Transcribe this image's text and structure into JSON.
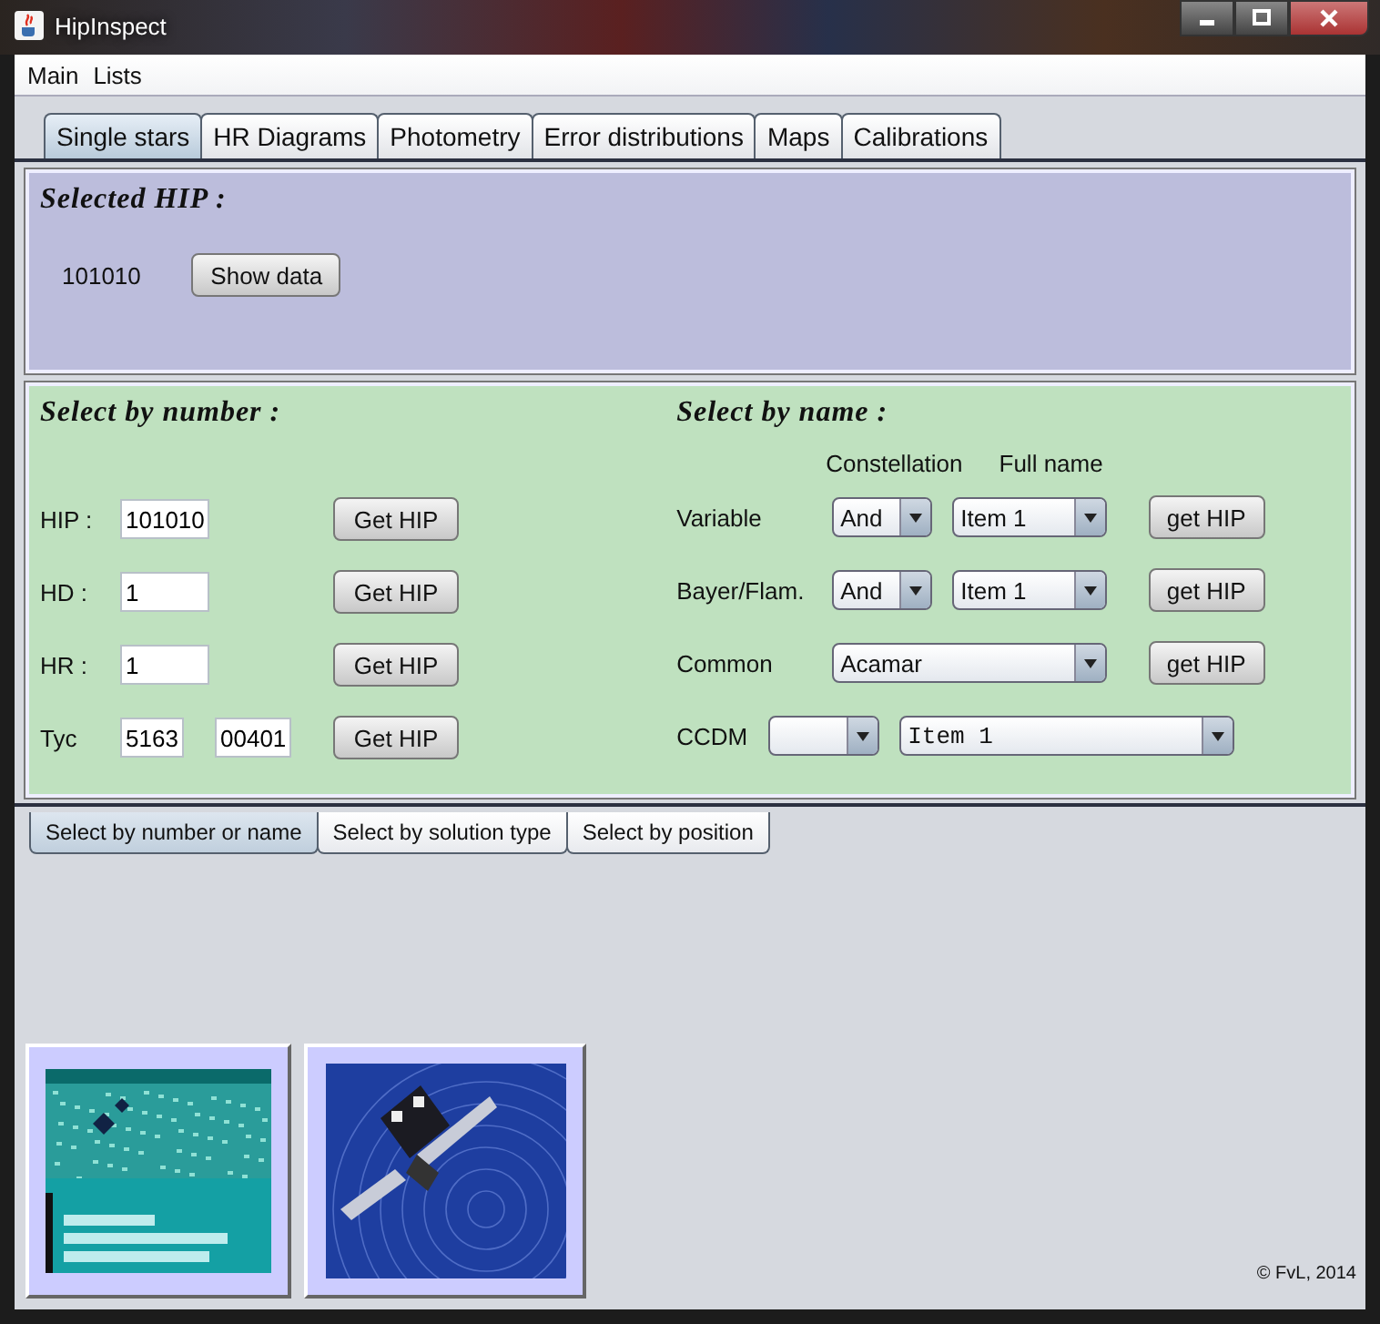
{
  "window": {
    "title": "HipInspect"
  },
  "menu": [
    "Main",
    "Lists"
  ],
  "tabs": [
    {
      "label": "Single stars",
      "selected": true
    },
    {
      "label": "HR Diagrams",
      "selected": false
    },
    {
      "label": "Photometry",
      "selected": false
    },
    {
      "label": "Error distributions",
      "selected": false
    },
    {
      "label": "Maps",
      "selected": false
    },
    {
      "label": "Calibrations",
      "selected": false
    }
  ],
  "selected_hip": {
    "heading": "Selected HIP :",
    "value": "101010",
    "button": "Show data"
  },
  "select_by_number": {
    "heading": "Select by number :",
    "rows": [
      {
        "label": "HIP :",
        "fields": [
          "101010"
        ],
        "button": "Get HIP"
      },
      {
        "label": "HD :",
        "fields": [
          "1"
        ],
        "button": "Get HIP"
      },
      {
        "label": "HR :",
        "fields": [
          "1"
        ],
        "button": "Get HIP"
      },
      {
        "label": "Tyc",
        "fields": [
          "5163",
          "00401"
        ],
        "button": "Get HIP"
      }
    ]
  },
  "select_by_name": {
    "heading": "Select by name :",
    "columns": [
      "Constellation",
      "Full name"
    ],
    "rows": [
      {
        "kind": "pair",
        "label": "Variable",
        "combos": [
          {
            "value": "And"
          },
          {
            "value": "Item 1"
          }
        ],
        "button": "get HIP"
      },
      {
        "kind": "pair",
        "label": "Bayer/Flam.",
        "combos": [
          {
            "value": "And"
          },
          {
            "value": "Item 1"
          }
        ],
        "button": "get HIP"
      },
      {
        "kind": "single",
        "label": "Common",
        "combos": [
          {
            "value": "Acamar"
          }
        ],
        "button": "get HIP"
      },
      {
        "kind": "ccdm",
        "label": "CCDM",
        "combos": [
          {
            "value": "Item 1"
          }
        ]
      }
    ]
  },
  "subtabs": [
    {
      "label": "Select by number or name",
      "selected": true
    },
    {
      "label": "Select by solution type",
      "selected": false
    },
    {
      "label": "Select by position",
      "selected": false
    }
  ],
  "thumbnails": [
    {
      "kind": "picture"
    },
    {
      "kind": "picture"
    }
  ],
  "footer": "© FvL, 2014"
}
